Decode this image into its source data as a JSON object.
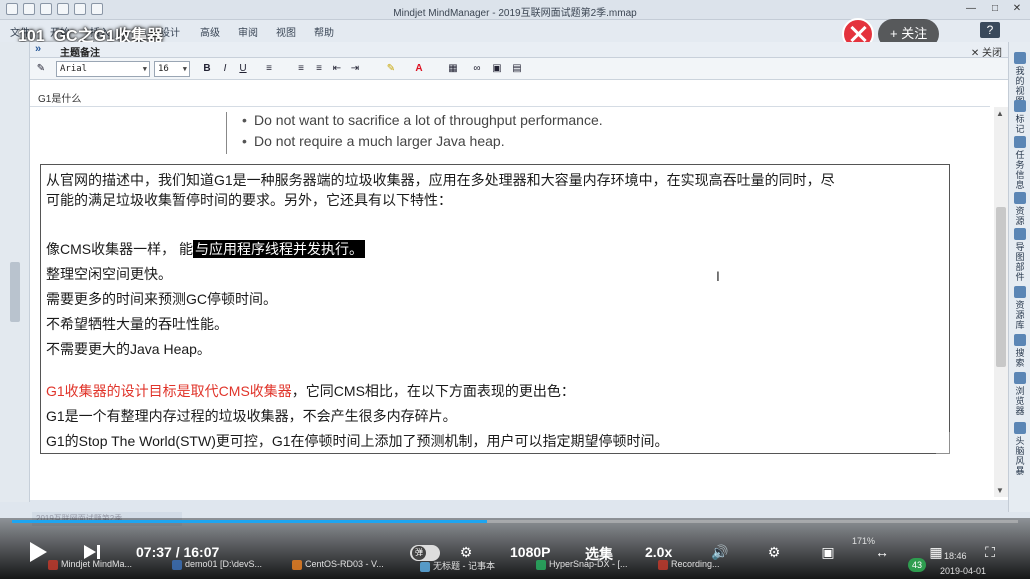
{
  "window": {
    "title": "Mindjet MindManager - 2019互联网面试题第2季.mmap",
    "help_label": "?"
  },
  "ribbon": {
    "tabs": [
      "文件",
      "开始",
      "插入",
      "设计",
      "高级",
      "审阅",
      "视图",
      "帮助"
    ],
    "close_label": "关闭"
  },
  "video": {
    "title": "101_GC之G1收集器",
    "follow_label": "关注",
    "follow_plus": "+",
    "current_time": "07:37",
    "duration": "16:07",
    "time_sep": "/",
    "played_fraction": 0.472,
    "danmu_label": "弹",
    "quality_label": "1080P",
    "episodes_label": "选集",
    "speed_label": "2.0x",
    "zoom_label": "171%"
  },
  "notes_panel": {
    "chevron": "»",
    "header_label": "主题备注",
    "font_name": "Arial",
    "font_size": "16"
  },
  "toolbar": {
    "bold": "B",
    "italic": "I",
    "underline": "U"
  },
  "document": {
    "path_label": "G1是什么",
    "bullets": [
      "Do not want to sacrifice a lot of throughput performance.",
      "Do not require a much larger Java heap."
    ],
    "para1_line1": "从官网的描述中，我们知道G1是一种服务器端的垃圾收集器，应用在多处理器和大容量内存环境中，在实现高吞吐量的同时，尽",
    "para1_line2": "可能的满足垃圾收集暂停时间的要求。另外，它还具有以下特性：",
    "feature1_prefix": "像CMS收集器一样，  能",
    "feature1_highlight": "与应用程序线程并发执行。",
    "feature2": "整理空闲空间更快。",
    "feature3": "需要更多的时间来预测GC停顿时间。",
    "feature4": "不希望牺牲大量的吞吐性能。",
    "feature5": "不需要更大的Java Heap。",
    "goal_red": "G1收集器的设计目标是取代CMS收集器",
    "goal_rest": "，它同CMS相比，在以下方面表现的更出色：",
    "point1": "G1是一个有整理内存过程的垃圾收集器，不会产生很多内存碎片。",
    "point2": "G1的Stop The World(STW)更可控，G1在停顿时间上添加了预测机制，用户可以指定期望停顿时间。",
    "mini_tab": "2019互联网面试题第2季"
  },
  "right_panel": {
    "items": [
      "我的视图",
      "标记",
      "任务信息",
      "资源",
      "导图部件",
      "资源库",
      "搜索",
      "浏览器",
      "头脑风暴"
    ]
  },
  "taskbar": {
    "items": [
      {
        "label": "Mindjet MindMa...",
        "color": "#c0392b"
      },
      {
        "label": "demo01 [D:\\devS...",
        "color": "#3b6fb6"
      },
      {
        "label": "CentOS-RD03 - V...",
        "color": "#e67e22"
      },
      {
        "label": "无标题 - 记事本",
        "color": "#5dade2"
      },
      {
        "label": "HyperSnap-DX - [...",
        "color": "#27ae60"
      },
      {
        "label": "Recording...",
        "color": "#c0392b"
      }
    ],
    "tray_badge": "43",
    "tray_chars": "中",
    "time": "18:46",
    "date": "2019-04-01"
  }
}
